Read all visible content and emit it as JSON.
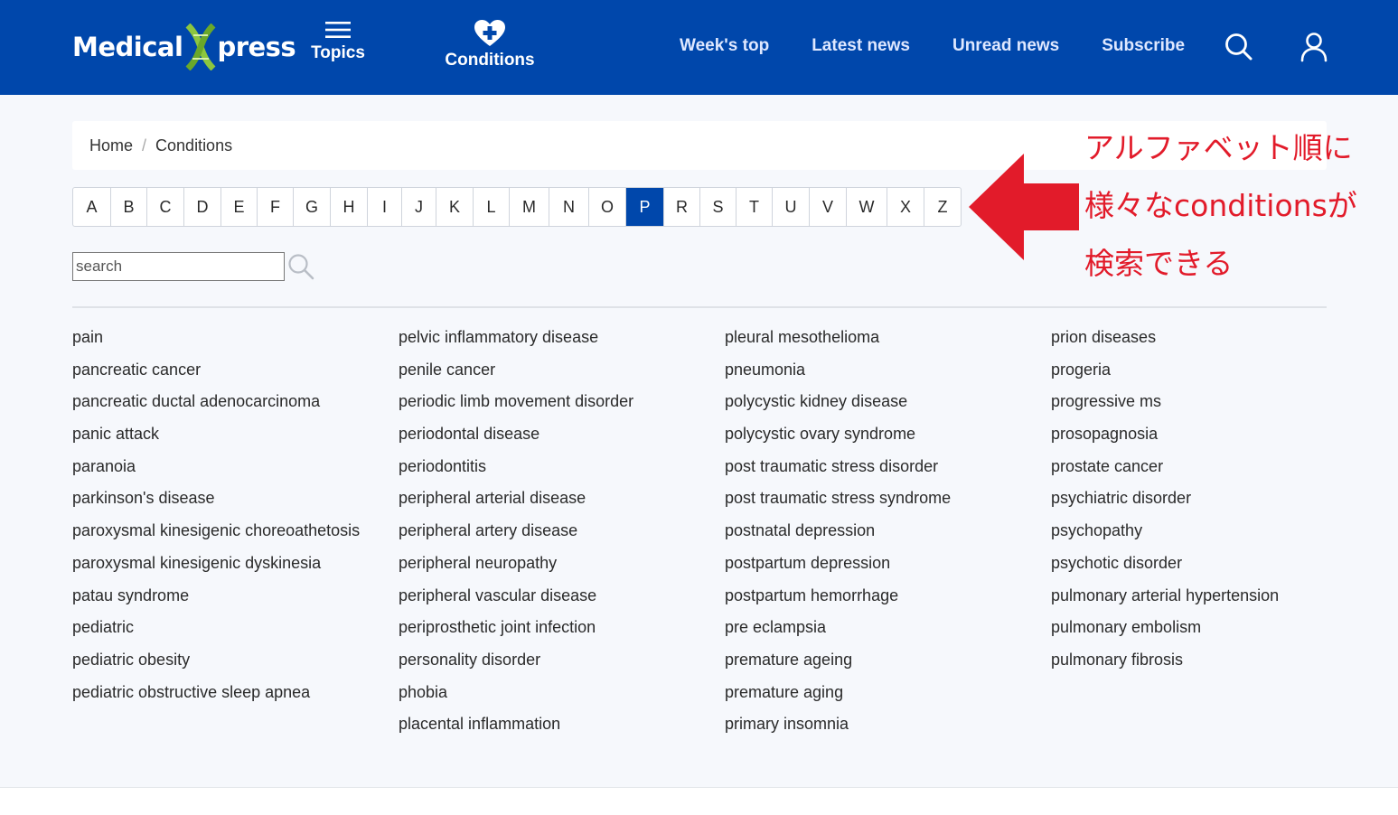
{
  "header": {
    "logo_part1": "Medical",
    "logo_part2": "press",
    "topics_label": "Topics",
    "conditions_label": "Conditions",
    "nav_links": [
      "Week's top",
      "Latest news",
      "Unread news",
      "Subscribe"
    ],
    "colors": {
      "bar": "#0047ab",
      "logo_x": "#8cc63f"
    }
  },
  "breadcrumb": {
    "home": "Home",
    "separator": "/",
    "current": "Conditions"
  },
  "letters": {
    "items": [
      "A",
      "B",
      "C",
      "D",
      "E",
      "F",
      "G",
      "H",
      "I",
      "J",
      "K",
      "L",
      "M",
      "N",
      "O",
      "P",
      "R",
      "S",
      "T",
      "U",
      "V",
      "W",
      "X",
      "Z"
    ],
    "active": "P"
  },
  "search": {
    "placeholder": "search",
    "icon": "search-icon"
  },
  "conditions": {
    "col1": [
      "pain",
      "pancreatic cancer",
      "pancreatic ductal adenocarcinoma",
      "panic attack",
      "paranoia",
      "parkinson's disease",
      "paroxysmal kinesigenic choreoathetosis",
      "paroxysmal kinesigenic dyskinesia",
      "patau syndrome",
      "pediatric",
      "pediatric obesity",
      "pediatric obstructive sleep apnea"
    ],
    "col2": [
      "pelvic inflammatory disease",
      "penile cancer",
      "periodic limb movement disorder",
      "periodontal disease",
      "periodontitis",
      "peripheral arterial disease",
      "peripheral artery disease",
      "peripheral neuropathy",
      "peripheral vascular disease",
      "periprosthetic joint infection",
      "personality disorder",
      "phobia",
      "placental inflammation"
    ],
    "col3": [
      "pleural mesothelioma",
      "pneumonia",
      "polycystic kidney disease",
      "polycystic ovary syndrome",
      "post traumatic stress disorder",
      "post traumatic stress syndrome",
      "postnatal depression",
      "postpartum depression",
      "postpartum hemorrhage",
      "pre eclampsia",
      "premature ageing",
      "premature aging",
      "primary insomnia"
    ],
    "col4": [
      "prion diseases",
      "progeria",
      "progressive ms",
      "prosopagnosia",
      "prostate cancer",
      "psychiatric disorder",
      "psychopathy",
      "psychotic disorder",
      "pulmonary arterial hypertension",
      "pulmonary embolism",
      "pulmonary fibrosis"
    ]
  },
  "annotation": {
    "lines": [
      "アルファベット順に",
      "様々なconditionsが",
      "検索できる"
    ],
    "color": "#e21b2a"
  }
}
